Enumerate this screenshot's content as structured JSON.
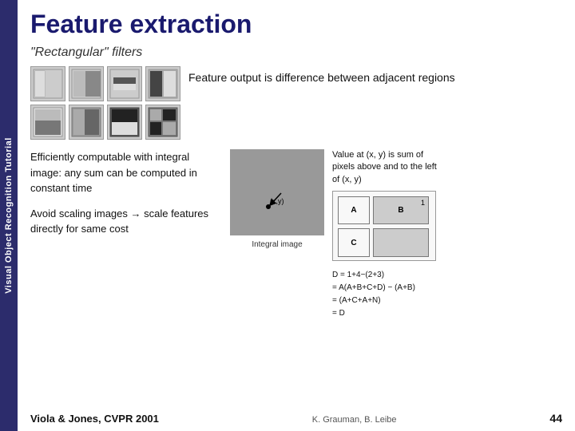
{
  "sidebar": {
    "label": "Visual Object Recognition Tutorial"
  },
  "header": {
    "title": "Feature extraction"
  },
  "filters_section": {
    "subtitle": "\"Rectangular\" filters",
    "feature_output_text": "Feature output is difference\nbetween adjacent regions"
  },
  "body": {
    "efficient_text": "Efficiently computable with integral image: any sum can be computed in constant time",
    "avoid_text": "Avoid scaling images → scale features directly for same cost",
    "value_note": "Value at (x, y) is sum of pixels above and to the left of (x, y)",
    "integral_caption": "Integral image",
    "formula_lines": [
      "D = 1+4-(2+3)",
      "= A(A+B+C+D) - (A+B)",
      "= (A+C+A+N)",
      "= D"
    ]
  },
  "footer": {
    "citation": "Viola & Jones, CVPR 2001",
    "author": "K. Grauman, B. Leibe",
    "page": "44"
  }
}
